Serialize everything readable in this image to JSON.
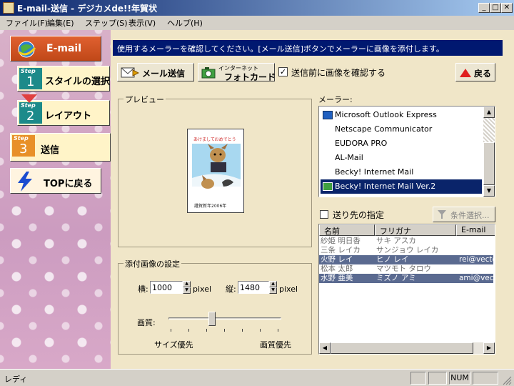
{
  "window": {
    "title": "E-mail-送信 - デジカメde!!年賀状"
  },
  "menu": [
    {
      "label": "ファイル(F)"
    },
    {
      "label": "編集(E)"
    },
    {
      "label": "ステップ(S)"
    },
    {
      "label": "表示(V)"
    },
    {
      "label": "ヘルプ(H)"
    }
  ],
  "sidebar": {
    "header": "E-mail",
    "step_tag": "Step",
    "steps": [
      {
        "num": "1",
        "label": "スタイルの選択"
      },
      {
        "num": "2",
        "label": "レイアウト"
      },
      {
        "num": "3",
        "label": "送信"
      }
    ],
    "top_button": "TOPに戻る"
  },
  "message": "使用するメーラーを確認してください。[メール送信]ボタンでメーラーに画像を添付します。",
  "toolbar": {
    "send_mail": "メール送信",
    "photocard_small": "インターネット",
    "photocard": "フォトカード",
    "confirm_checkbox": "送信前に画像を確認する",
    "back": "戻る"
  },
  "preview": {
    "title": "プレビュー",
    "card_text": "あけましておめでとう",
    "card_footer": "謹賀新年2006年"
  },
  "attach": {
    "title": "添付画像の設定",
    "width_label": "横:",
    "width_value": "1000",
    "height_label": "縦:",
    "height_value": "1480",
    "unit": "pixel",
    "quality_label": "画質:",
    "quality_level": 0.38,
    "left_caption": "サイズ優先",
    "right_caption": "画質優先"
  },
  "mailer": {
    "title": "メーラー:",
    "items": [
      {
        "label": "Microsoft Outlook Express",
        "icon": "outlook-icon"
      },
      {
        "label": "Netscape Communicator"
      },
      {
        "label": "EUDORA PRO"
      },
      {
        "label": "AL-Mail"
      },
      {
        "label": "Becky! Internet Mail"
      },
      {
        "label": "Becky! Internet Mail Ver.2",
        "icon": "becky-icon"
      }
    ],
    "selected": 5
  },
  "recipients": {
    "checkbox_label": "送り先の指定",
    "filter_button": "条件選択...",
    "columns": [
      "名前",
      "フリガナ",
      "E-mail"
    ],
    "rows": [
      {
        "name": "紗姫 明日香",
        "kana": "サキ アスカ",
        "email": ""
      },
      {
        "name": "三条 レイカ",
        "kana": "サンジョウ レイカ",
        "email": ""
      },
      {
        "name": "火野 レイ",
        "kana": "ヒノ レイ",
        "email": "rei@vector"
      },
      {
        "name": "松本 太郎",
        "kana": "マツモト タロウ",
        "email": ""
      },
      {
        "name": "水野 亜美",
        "kana": "ミズノ アミ",
        "email": "ami@vector"
      }
    ]
  },
  "status": {
    "text": "レディ",
    "num": "NUM"
  }
}
